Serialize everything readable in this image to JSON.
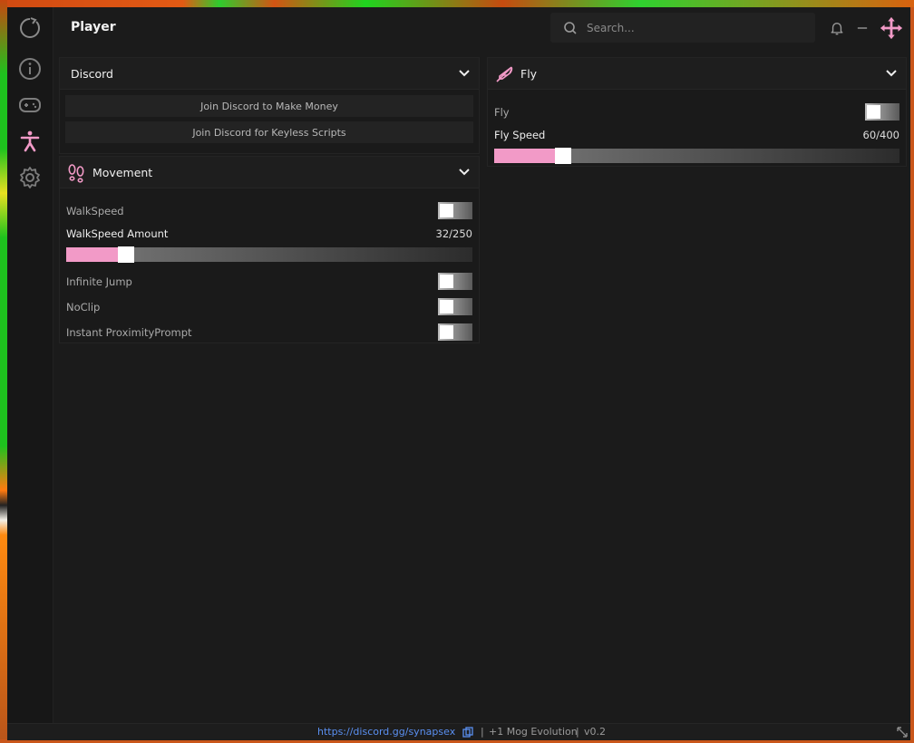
{
  "app": {
    "title": "Player"
  },
  "sidebar": {
    "items": [
      {
        "name": "logo-icon"
      },
      {
        "name": "info-icon"
      },
      {
        "name": "gamepad-icon"
      },
      {
        "name": "player-icon",
        "active": true
      },
      {
        "name": "gear-icon"
      }
    ]
  },
  "header": {
    "search_placeholder": "Search...",
    "icons": [
      "bell-icon",
      "minimize-icon",
      "move-icon"
    ]
  },
  "discord_panel": {
    "title": "Discord",
    "buttons": [
      "Join Discord to Make Money",
      "Join Discord for Keyless Scripts"
    ]
  },
  "movement_panel": {
    "title": "Movement",
    "walkspeed_label": "WalkSpeed",
    "walkspeed_enabled": false,
    "walkspeed_amount_label": "WalkSpeed Amount",
    "walkspeed_amount_value": "32/250",
    "walkspeed_amount_fraction": 0.128,
    "infinite_jump_label": "Infinite Jump",
    "infinite_jump_enabled": false,
    "noclip_label": "NoClip",
    "noclip_enabled": false,
    "instant_prompt_label": "Instant ProximityPrompt",
    "instant_prompt_enabled": false
  },
  "fly_panel": {
    "title": "Fly",
    "fly_label": "Fly",
    "fly_enabled": false,
    "fly_speed_label": "Fly Speed",
    "fly_speed_value": "60/400",
    "fly_speed_fraction": 0.15
  },
  "footer": {
    "link": "https://discord.gg/synapsex",
    "sep1": "|",
    "game": "+1 Mog Evolution",
    "sep2": "|",
    "version": "v0.2"
  },
  "colors": {
    "accent": "#f29ac7",
    "background": "#1b1b1b",
    "link": "#5a8ff0"
  }
}
